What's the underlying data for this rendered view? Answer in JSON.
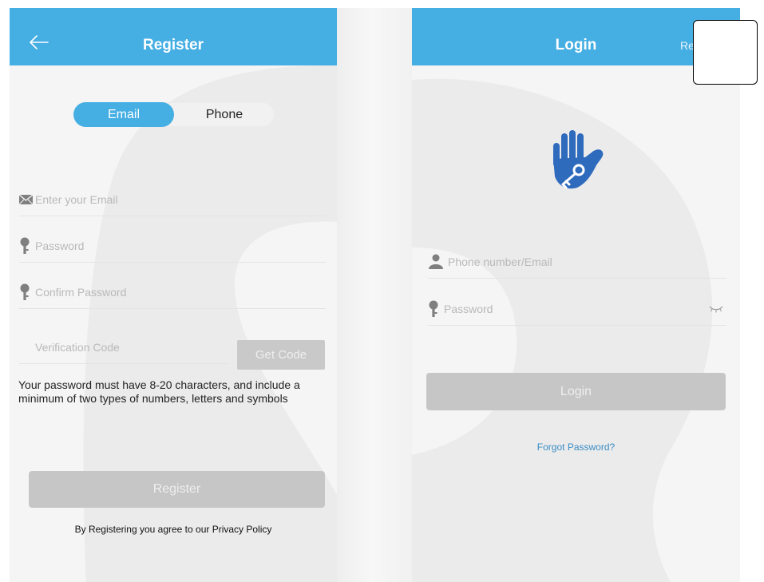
{
  "register": {
    "header": {
      "title": "Register"
    },
    "tabs": {
      "email": "Email",
      "phone": "Phone"
    },
    "fields": {
      "email_placeholder": "Enter your Email",
      "password_placeholder": "Password",
      "confirm_placeholder": "Confirm Password",
      "code_placeholder": "Verification Code"
    },
    "get_code_label": "Get Code",
    "hint": "Your password must have 8-20 characters, and include a minimum of two types of numbers, letters and symbols",
    "submit_label": "Register",
    "policy": "By Registering you agree to our Privacy Policy"
  },
  "login": {
    "header": {
      "title": "Login",
      "action": "Re"
    },
    "fields": {
      "account_placeholder": "Phone number/Email",
      "password_placeholder": "Password"
    },
    "submit_label": "Login",
    "forgot_label": "Forgot Password?"
  },
  "colors": {
    "accent": "#45aee3",
    "logo": "#2f6bbd",
    "button_disabled": "#c6c6c6",
    "link": "#3a8dc6",
    "placeholder": "#b9b9b9"
  },
  "icons": {
    "back": "arrow-left-icon",
    "email": "envelope-icon",
    "password": "key-pin-icon",
    "account": "person-icon",
    "visibility": "eye-closed-icon",
    "logo": "hand-key-icon"
  }
}
